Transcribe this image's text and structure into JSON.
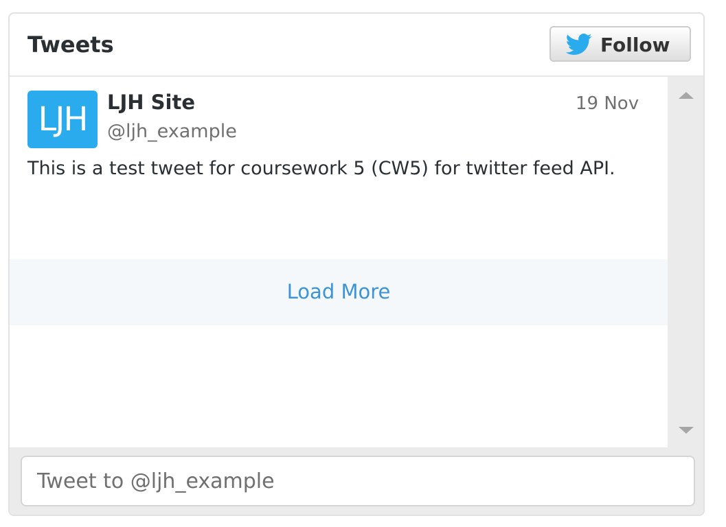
{
  "header": {
    "title": "Tweets",
    "follow_label": "Follow"
  },
  "tweet": {
    "avatar_text": "LJH",
    "name": "LJH Site",
    "handle": "@ljh_example",
    "date": "19 Nov",
    "text": "This is a test tweet for coursework 5 (CW5) for twitter feed API."
  },
  "load_more": {
    "label": "Load More"
  },
  "composer": {
    "placeholder": "Tweet to @ljh_example"
  },
  "colors": {
    "accent": "#3b94d9",
    "twitter_blue": "#2aabee",
    "avatar_bg": "#2aabee"
  },
  "icons": {
    "follow_icon": "twitter-bird-icon",
    "scroll_up": "scroll-up-arrow-icon",
    "scroll_down": "scroll-down-arrow-icon"
  }
}
